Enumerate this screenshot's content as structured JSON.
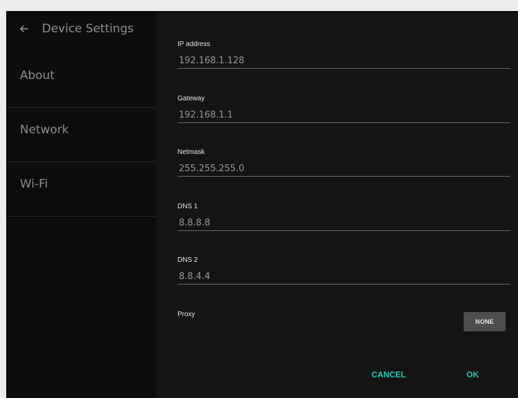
{
  "sidebar": {
    "title": "Device Settings",
    "back_icon": "arrow-left-icon",
    "items": [
      {
        "label": "About"
      },
      {
        "label": "Network"
      },
      {
        "label": "Wi-Fi"
      }
    ]
  },
  "form": {
    "ip": {
      "label": "IP address",
      "value": "192.168.1.128"
    },
    "gateway": {
      "label": "Gateway",
      "value": "192.168.1.1"
    },
    "netmask": {
      "label": "Netmask",
      "value": "255.255.255.0"
    },
    "dns1": {
      "label": "DNS 1",
      "value": "8.8.8.8"
    },
    "dns2": {
      "label": "DNS 2",
      "value": "8.8.4.4"
    },
    "proxy": {
      "label": "Proxy",
      "button_label": "NONE"
    }
  },
  "actions": {
    "cancel_label": "CANCEL",
    "ok_label": "OK"
  },
  "colors": {
    "accent": "#26c6b0",
    "background": "#141414",
    "sidebar": "#0c0c0c"
  }
}
